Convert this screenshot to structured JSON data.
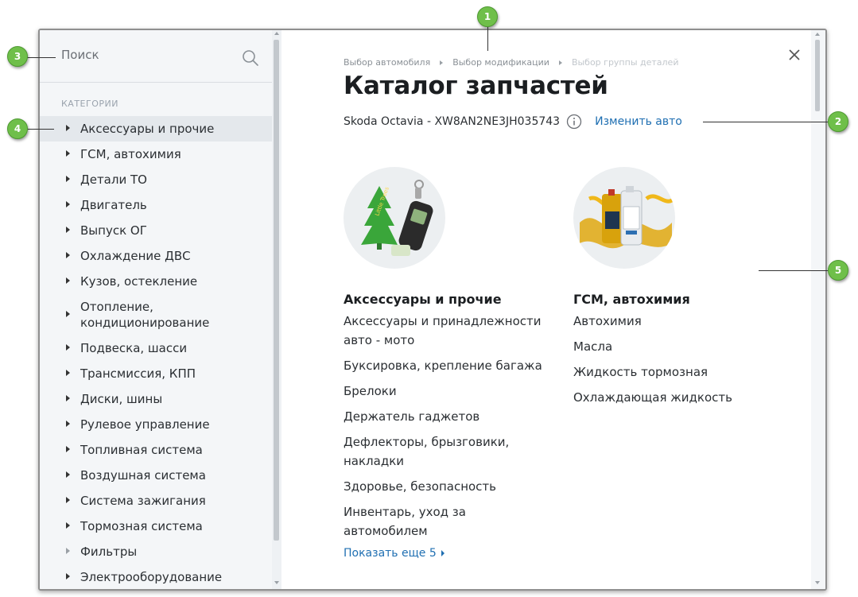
{
  "search": {
    "placeholder": "Поиск"
  },
  "sidebar": {
    "section_title": "КАТЕГОРИИ",
    "items": [
      {
        "label": "Аксессуары и прочие"
      },
      {
        "label": "ГСМ, автохимия"
      },
      {
        "label": "Детали ТО"
      },
      {
        "label": "Двигатель"
      },
      {
        "label": "Выпуск ОГ"
      },
      {
        "label": "Охлаждение ДВС"
      },
      {
        "label": "Кузов, остекление"
      },
      {
        "label": "Отопление, кондиционирование"
      },
      {
        "label": "Подвеска, шасси"
      },
      {
        "label": "Трансмиссия, КПП"
      },
      {
        "label": "Диски, шины"
      },
      {
        "label": "Рулевое управление"
      },
      {
        "label": "Топливная система"
      },
      {
        "label": "Воздушная система"
      },
      {
        "label": "Система зажигания"
      },
      {
        "label": "Тормозная система"
      },
      {
        "label": "Фильтры"
      },
      {
        "label": "Электрооборудование"
      }
    ]
  },
  "breadcrumb": [
    "Выбор автомобиля",
    "Выбор модификации",
    "Выбор группы деталей"
  ],
  "main": {
    "title": "Каталог запчастей",
    "vehicle": "Skoda Octavia - XW8AN2NE3JH035743",
    "change_link": "Изменить авто",
    "columns": [
      {
        "title": "Аксессуары и прочие",
        "items": [
          "Аксессуары и принадлежности авто - мото",
          "Буксировка, крепление багажа",
          "Брелоки",
          "Держатель гаджетов",
          "Дефлекторы, брызговики, накладки",
          "Здоровье, безопасность",
          "Инвентарь, уход за автомобилем"
        ],
        "more": "Показать еще 5"
      },
      {
        "title": "ГСМ, автохимия",
        "items": [
          "Автохимия",
          "Масла",
          "Жидкость тормозная",
          "Охлаждающая жидкость"
        ]
      }
    ]
  },
  "callouts": [
    "1",
    "2",
    "3",
    "4",
    "5"
  ],
  "colors": {
    "accent_link": "#1f6fb2",
    "callout_green": "#6fbf4a",
    "sidebar_bg": "#f4f6f8"
  }
}
